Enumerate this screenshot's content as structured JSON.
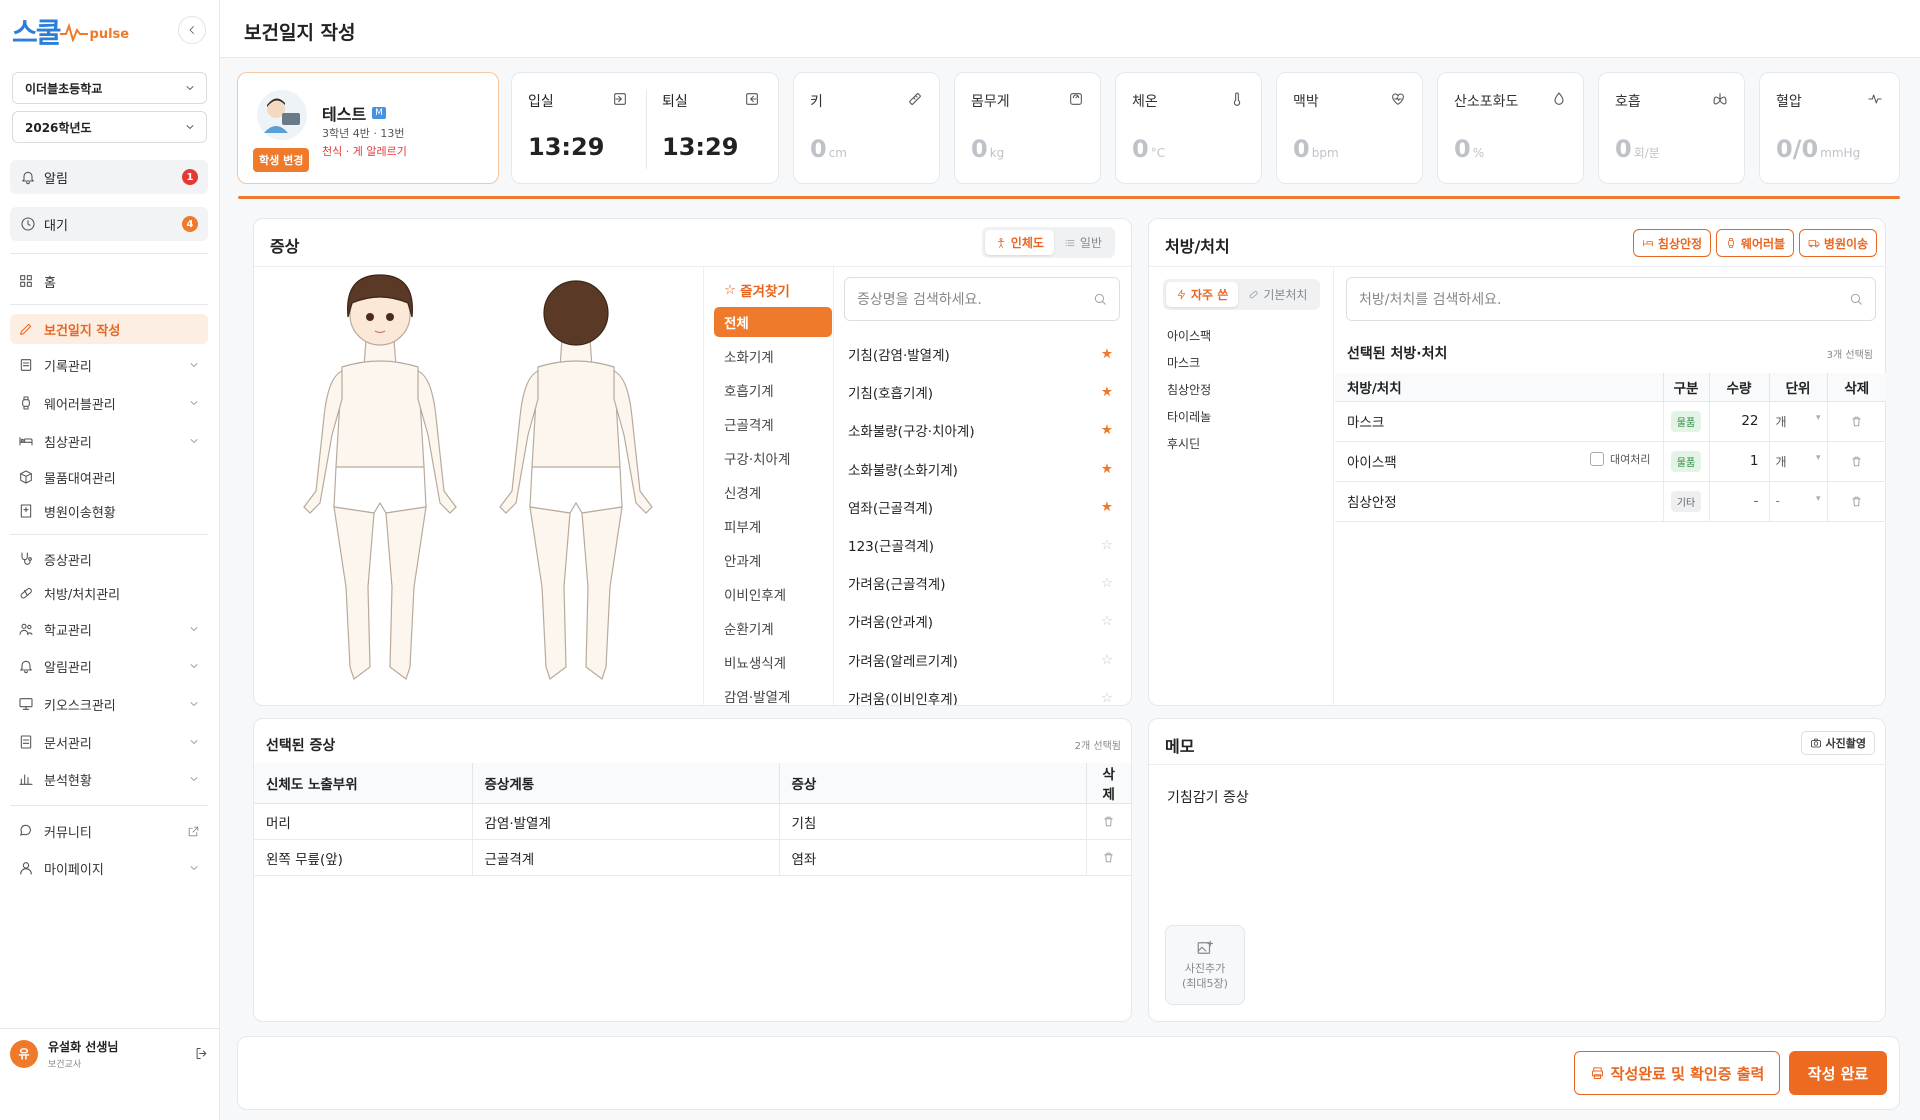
{
  "brand": {
    "logo_korean": "스쿨",
    "logo_pulse": "pulse"
  },
  "sidebar": {
    "school": "이더블초등학교",
    "year": "2026학년도",
    "alert": {
      "label": "알림",
      "count": "1"
    },
    "wait": {
      "label": "대기",
      "count": "4"
    },
    "nav": [
      {
        "label": "홈"
      },
      {
        "label": "보건일지 작성"
      },
      {
        "label": "기록관리"
      },
      {
        "label": "웨어러블관리"
      },
      {
        "label": "침상관리"
      },
      {
        "label": "물품대여관리"
      },
      {
        "label": "병원이송현황"
      },
      {
        "label": "증상관리"
      },
      {
        "label": "처방/처치관리"
      },
      {
        "label": "학교관리"
      },
      {
        "label": "알림관리"
      },
      {
        "label": "키오스크관리"
      },
      {
        "label": "문서관리"
      },
      {
        "label": "분석현황"
      },
      {
        "label": "커뮤니티"
      },
      {
        "label": "마이페이지"
      }
    ],
    "user": {
      "initial": "유",
      "name": "유설화 선생님",
      "role": "보건교사"
    }
  },
  "header": {
    "title": "보건일지 작성"
  },
  "student": {
    "name": "테스트",
    "gender": "M",
    "info": "3학년 4반 · 13번",
    "allergy": "천식 · 게 알레르기",
    "change_label": "학생 변경"
  },
  "times": {
    "in_label": "입실",
    "in_value": "13:29",
    "out_label": "퇴실",
    "out_value": "13:29"
  },
  "vitals": [
    {
      "label": "키",
      "value": "0",
      "unit": "cm",
      "icon": "ruler-icon"
    },
    {
      "label": "몸무게",
      "value": "0",
      "unit": "kg",
      "icon": "scale-icon"
    },
    {
      "label": "체온",
      "value": "0",
      "unit": "°C",
      "icon": "thermometer-icon"
    },
    {
      "label": "맥박",
      "value": "0",
      "unit": "bpm",
      "icon": "heart-pulse-icon"
    },
    {
      "label": "산소포화도",
      "value": "0",
      "unit": "%",
      "icon": "droplet-icon"
    },
    {
      "label": "호흡",
      "value": "0",
      "unit": "회/분",
      "icon": "lungs-icon"
    },
    {
      "label": "혈압",
      "value": "0/0",
      "unit": "mmHg",
      "icon": "activity-icon"
    }
  ],
  "symptoms": {
    "title": "증상",
    "toggle": {
      "body": "인체도",
      "normal": "일반"
    },
    "favorites_label": "즐겨찾기",
    "categories": [
      "전체",
      "소화기계",
      "호흡기계",
      "근골격계",
      "구강·치아계",
      "신경계",
      "피부계",
      "안과계",
      "이비인후계",
      "순환기계",
      "비뇨생식계",
      "감염·발열계"
    ],
    "search_placeholder": "증상명을 검색하세요.",
    "items": [
      {
        "name": "기침(감염·발열계)",
        "fav": true
      },
      {
        "name": "기침(호흡기계)",
        "fav": true
      },
      {
        "name": "소화불량(구강·치아계)",
        "fav": true
      },
      {
        "name": "소화불량(소화기계)",
        "fav": true
      },
      {
        "name": "염좌(근골격계)",
        "fav": true
      },
      {
        "name": "123(근골격계)",
        "fav": false
      },
      {
        "name": "가려움(근골격계)",
        "fav": false
      },
      {
        "name": "가려움(안과계)",
        "fav": false
      },
      {
        "name": "가려움(알레르기계)",
        "fav": false
      },
      {
        "name": "가려움(이비인후계)",
        "fav": false
      }
    ]
  },
  "selected_symptoms": {
    "title": "선택된 증상",
    "count": "2개 선택됨",
    "headers": [
      "신체도 노출부위",
      "증상계통",
      "증상",
      "삭제"
    ],
    "rows": [
      {
        "part": "머리",
        "system": "감염·발열계",
        "symptom": "기침"
      },
      {
        "part": "왼쪽 무릎(앞)",
        "system": "근골격계",
        "symptom": "염좌"
      }
    ]
  },
  "treatment": {
    "title": "처방/처치",
    "actions": [
      "침상안정",
      "웨어러블",
      "병원이송"
    ],
    "toggle": {
      "frequent": "자주 쓴",
      "basic": "기본처치"
    },
    "quick": [
      "아이스팩",
      "마스크",
      "침상안정",
      "타이레놀",
      "후시딘"
    ],
    "search_placeholder": "처방/처치를 검색하세요.",
    "selected_title": "선택된 처방·처치",
    "selected_count": "3개 선택됨",
    "headers": [
      "처방/처치",
      "구분",
      "수량",
      "단위",
      "삭제"
    ],
    "rows": [
      {
        "name": "마스크",
        "type": "물품",
        "qty": "22",
        "unit": "개",
        "rent": ""
      },
      {
        "name": "아이스팩",
        "type": "물품",
        "qty": "1",
        "unit": "개",
        "rent": "대여처리"
      },
      {
        "name": "침상안정",
        "type": "기타",
        "qty": "-",
        "unit": "-",
        "rent": ""
      }
    ]
  },
  "memo": {
    "title": "메모",
    "photo_btn": "사진촬영",
    "text": "기침감기 증상",
    "add_photo": "사진추가",
    "add_photo_limit": "(최대5장)"
  },
  "footer": {
    "print_label": "작성완료 및 확인증 출력",
    "complete_label": "작성 완료"
  },
  "colors": {
    "accent": "#f07a2b",
    "brand_blue": "#2b7fd6",
    "alert_red": "#e53935"
  }
}
